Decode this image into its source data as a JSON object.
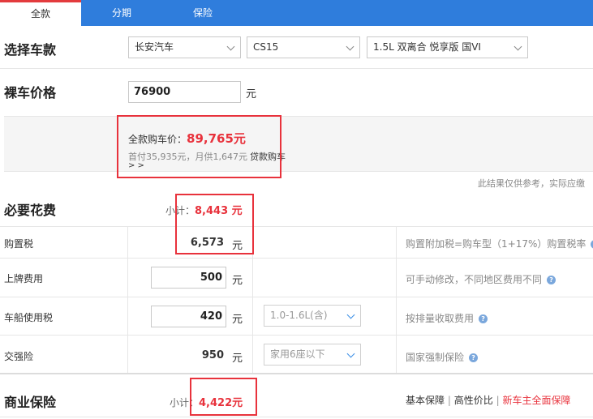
{
  "tabs": [
    {
      "label": "全款",
      "active": true
    },
    {
      "label": "分期",
      "active": false
    },
    {
      "label": "保险",
      "active": false
    }
  ],
  "select_car": {
    "title": "选择车款",
    "brand": "长安汽车",
    "model": "CS15",
    "variant": "1.5L 双离合 悦享版 国VI"
  },
  "bare_price": {
    "title": "裸车价格",
    "value": "76900",
    "unit": "元"
  },
  "summary": {
    "full_label": "全款购车价：",
    "full_value": "89,765元",
    "loan_line": "首付35,935元，月供1,647元",
    "loan_link": "贷款购车",
    "more": "> >",
    "disclaimer": "此结果仅供参考，实际应缴"
  },
  "required_fees": {
    "title": "必要花费",
    "subtotal_label": "小计：",
    "subtotal_value": "8,443 元",
    "rows": [
      {
        "label": "购置税",
        "value": "6,573",
        "unit": "元",
        "note": "购置附加税=购车型（1+17%）购置税率"
      },
      {
        "label": "上牌费用",
        "value": "500",
        "unit": "元",
        "note": "可手动修改，不同地区费用不同"
      },
      {
        "label": "车船使用税",
        "value": "420",
        "unit": "元",
        "option": "1.0-1.6L(含)",
        "note": "按排量收取费用"
      },
      {
        "label": "交强险",
        "value": "950",
        "unit": "元",
        "option": "家用6座以下",
        "note": "国家强制保险"
      }
    ]
  },
  "commercial_insurance": {
    "title": "商业保险",
    "subtotal_label": "小计：",
    "subtotal_value": "4,422元",
    "links": [
      "基本保障",
      "高性价比",
      "新车主全面保障"
    ],
    "divider": "|"
  },
  "icons": {
    "help": "help-icon",
    "chevron": "chevron-down-icon"
  },
  "colors": {
    "accent": "#2f7ddc",
    "highlight": "#e8323c"
  }
}
